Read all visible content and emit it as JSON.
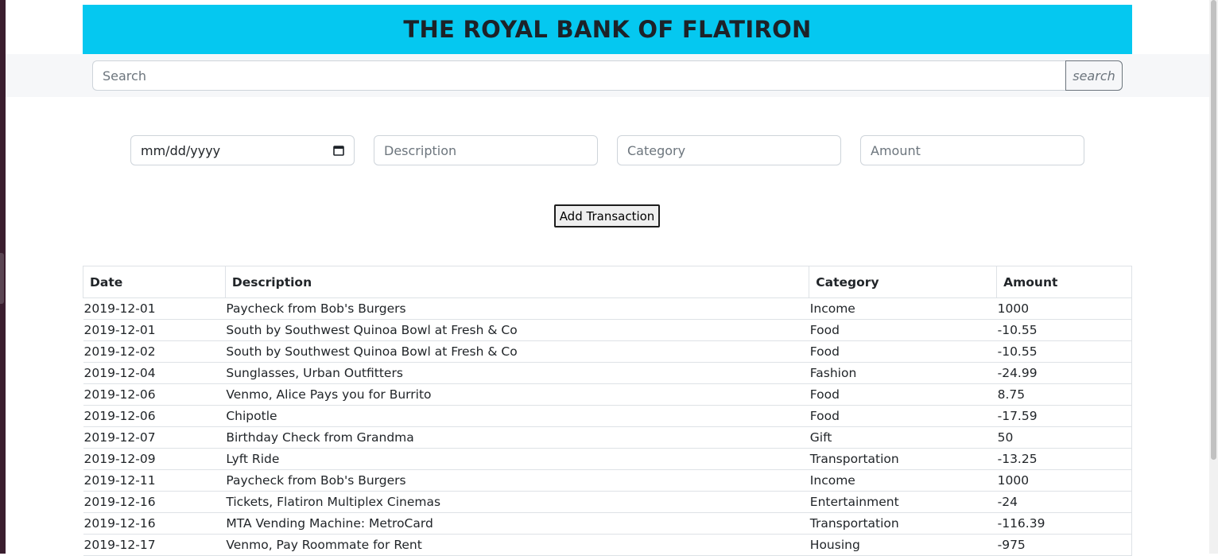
{
  "header": {
    "title": "THE ROYAL BANK OF FLATIRON"
  },
  "search": {
    "placeholder": "Search",
    "button_label": "search"
  },
  "form": {
    "date_placeholder": "mm/dd/yyyy",
    "description_placeholder": "Description",
    "category_placeholder": "Category",
    "amount_placeholder": "Amount",
    "submit_label": "Add Transaction"
  },
  "table": {
    "headers": [
      "Date",
      "Description",
      "Category",
      "Amount"
    ],
    "rows": [
      {
        "date": "2019-12-01",
        "description": "Paycheck from Bob's Burgers",
        "category": "Income",
        "amount": "1000"
      },
      {
        "date": "2019-12-01",
        "description": "South by Southwest Quinoa Bowl at Fresh & Co",
        "category": "Food",
        "amount": "-10.55"
      },
      {
        "date": "2019-12-02",
        "description": "South by Southwest Quinoa Bowl at Fresh & Co",
        "category": "Food",
        "amount": "-10.55"
      },
      {
        "date": "2019-12-04",
        "description": "Sunglasses, Urban Outfitters",
        "category": "Fashion",
        "amount": "-24.99"
      },
      {
        "date": "2019-12-06",
        "description": "Venmo, Alice Pays you for Burrito",
        "category": "Food",
        "amount": "8.75"
      },
      {
        "date": "2019-12-06",
        "description": "Chipotle",
        "category": "Food",
        "amount": "-17.59"
      },
      {
        "date": "2019-12-07",
        "description": "Birthday Check from Grandma",
        "category": "Gift",
        "amount": "50"
      },
      {
        "date": "2019-12-09",
        "description": "Lyft Ride",
        "category": "Transportation",
        "amount": "-13.25"
      },
      {
        "date": "2019-12-11",
        "description": "Paycheck from Bob's Burgers",
        "category": "Income",
        "amount": "1000"
      },
      {
        "date": "2019-12-16",
        "description": "Tickets, Flatiron Multiplex Cinemas",
        "category": "Entertainment",
        "amount": "-24"
      },
      {
        "date": "2019-12-16",
        "description": "MTA Vending Machine: MetroCard",
        "category": "Transportation",
        "amount": "-116.39"
      },
      {
        "date": "2019-12-17",
        "description": "Venmo, Pay Roommate for Rent",
        "category": "Housing",
        "amount": "-975"
      }
    ]
  },
  "colors": {
    "header_background": "#05c8f0",
    "search_bar_background": "#f6f7f9",
    "border": "#dee2e6"
  }
}
